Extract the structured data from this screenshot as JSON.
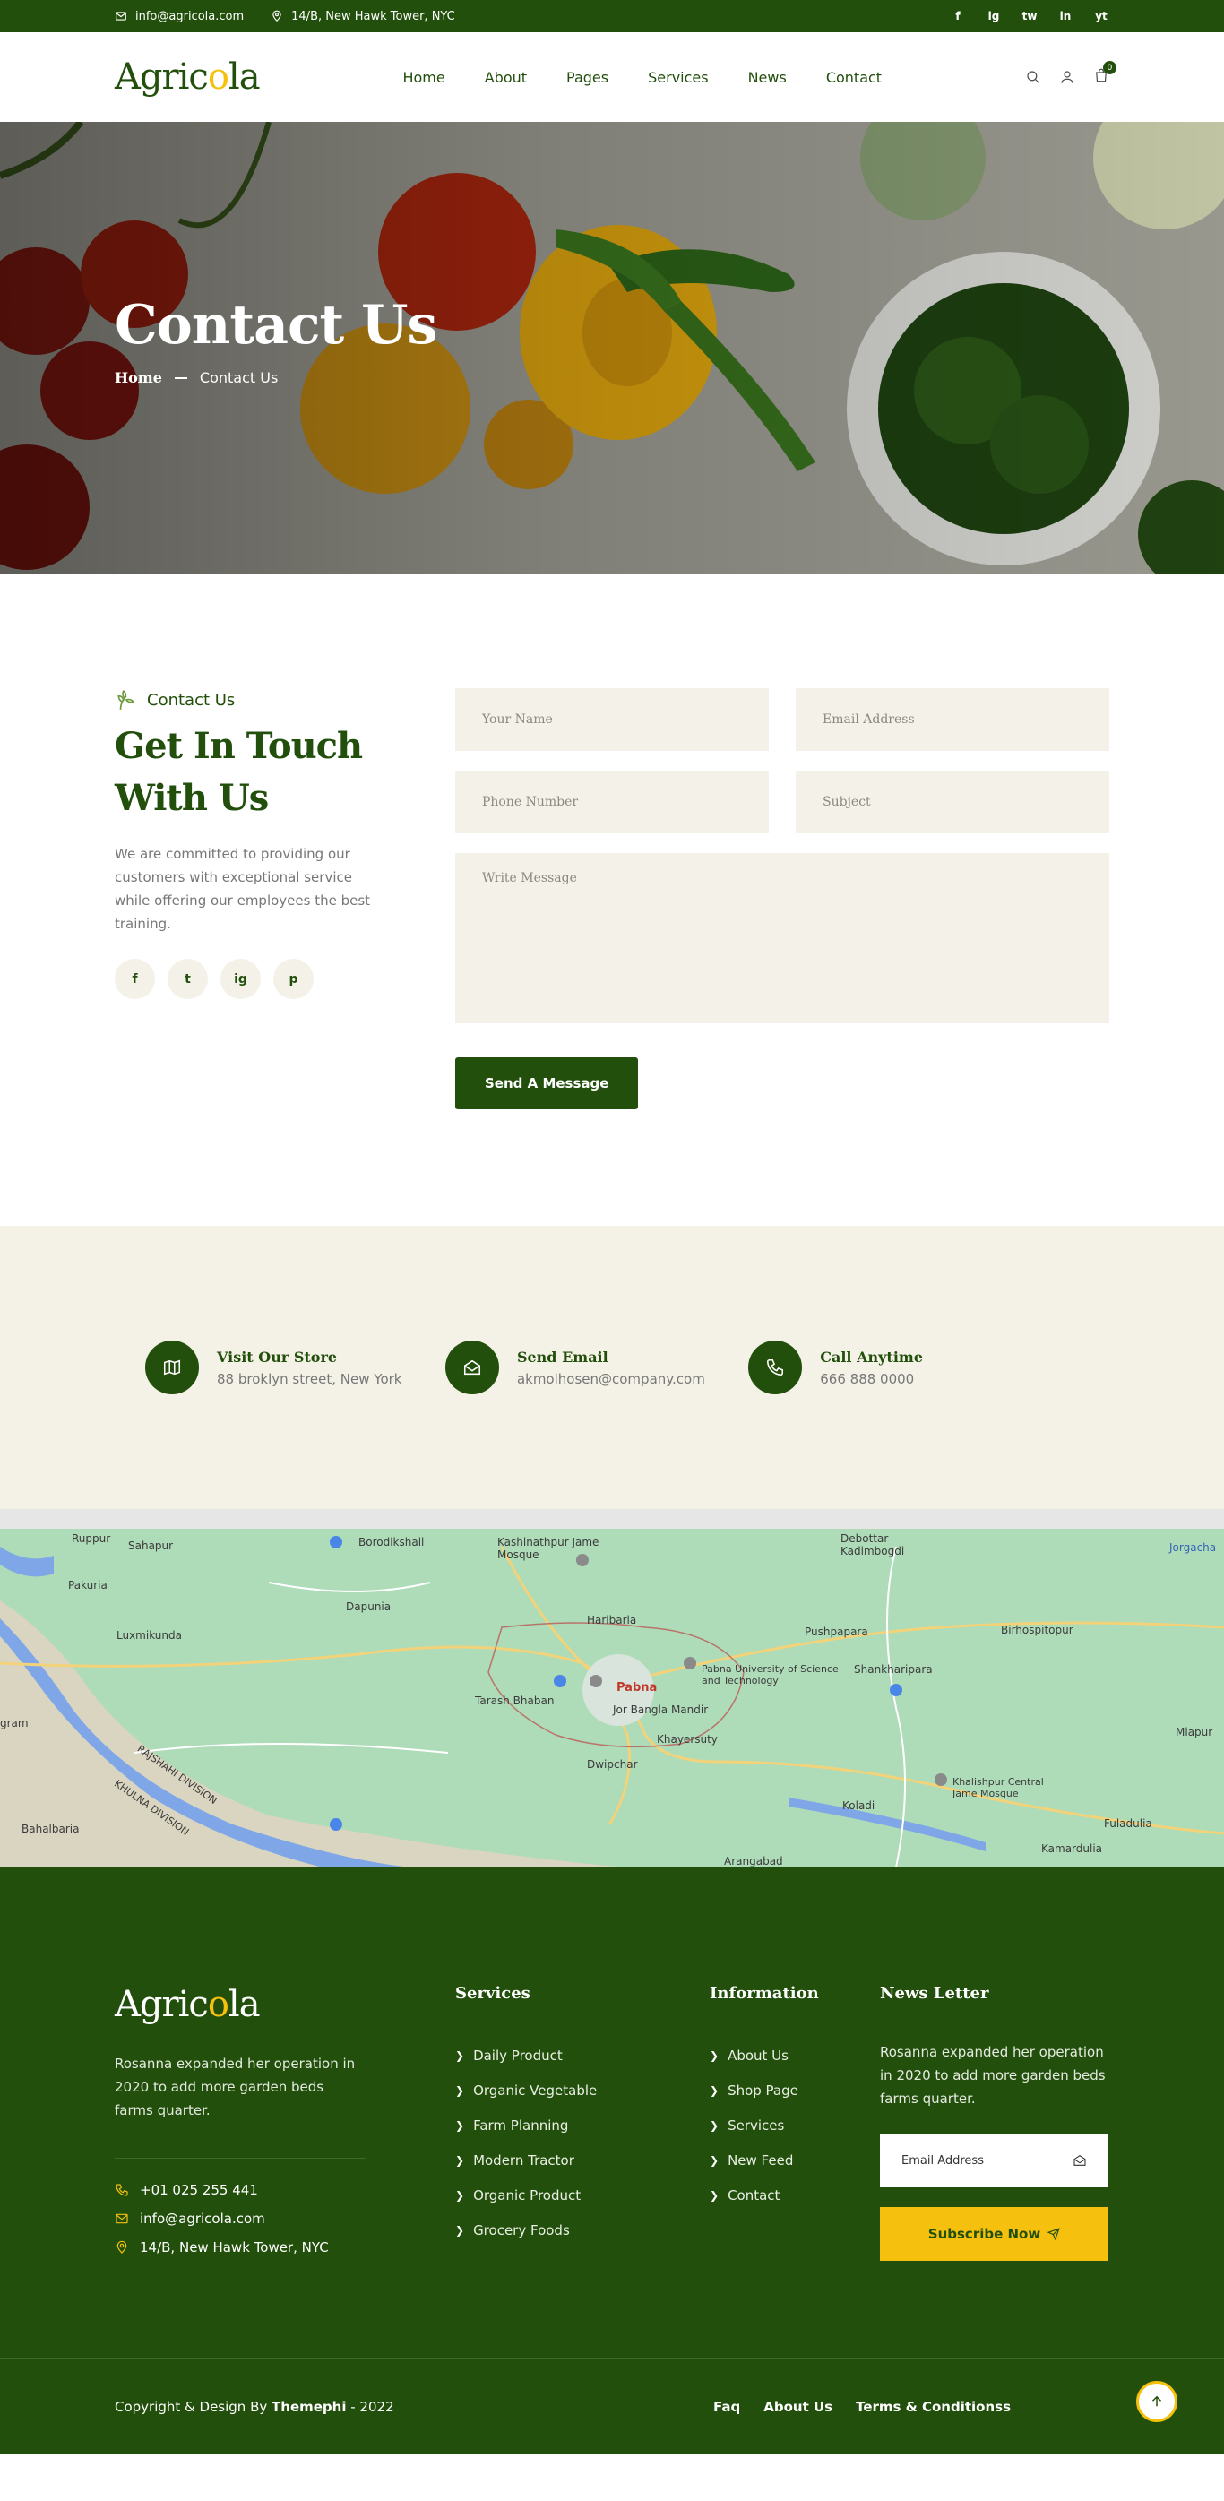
{
  "topbar": {
    "email": "info@agricola.com",
    "address": "14/B, New Hawk Tower, NYC",
    "social": [
      "f",
      "ig",
      "tw",
      "in",
      "yt"
    ]
  },
  "header": {
    "logo_pre": "Agric",
    "logo_o": "o",
    "logo_post": "la",
    "nav": [
      "Home",
      "About",
      "Pages",
      "Services",
      "News",
      "Contact"
    ],
    "cart_count": "0"
  },
  "hero": {
    "title": "Contact Us",
    "crumb_home": "Home",
    "crumb_current": "Contact Us"
  },
  "contact": {
    "eyebrow": "Contact Us",
    "heading_line1": "Get In Touch",
    "heading_line2": "With Us",
    "lead": "We are committed to providing our customers with exceptional service while offering our employees the best training.",
    "social": [
      "f",
      "t",
      "ig",
      "p"
    ],
    "placeholders": {
      "name": "Your Name",
      "email": "Email Address",
      "phone": "Phone Number",
      "subject": "Subject",
      "message": "Write Message"
    },
    "send_label": "Send A Message"
  },
  "info": [
    {
      "title": "Visit Our Store",
      "value": "88 broklyn street, New York",
      "icon": "map-icon"
    },
    {
      "title": "Send Email",
      "value": "akmolhosen@company.com",
      "icon": "mail-open-icon"
    },
    {
      "title": "Call Anytime",
      "value": "666 888 0000",
      "icon": "phone-icon"
    }
  ],
  "map": {
    "labels": {
      "ruppur": "Ruppur",
      "sahapur": "Sahapur",
      "borodikshail": "Borodikshail",
      "kashinathpur": "Kashinathpur Jame Mosque",
      "debottar": "Debottar Kadimbogdi",
      "jorgacha": "Jorgacha",
      "pakuria": "Pakuria",
      "dapunia": "Dapunia",
      "haribaria": "Haribaria",
      "pushpapara": "Pushpapara",
      "birhospitopur": "Birhospitopur",
      "luxmikunda": "Luxmikunda",
      "shankharipara": "Shankharipara",
      "pabna": "Pabna",
      "pabna_uni": "Pabna University of Science and Technology",
      "tarash": "Tarash Bhaban",
      "jor_bangla": "Jor Bangla Mandir",
      "khayersuty": "Khayersuty",
      "dwipchar": "Dwipchar",
      "miapur": "Miapur",
      "rajshahi": "RAJSHAHI DIVISION",
      "khulna": "KHULNA DIVISION",
      "bahalbaria": "Bahalbaria",
      "koladi": "Koladi",
      "khalishpur": "Khalishpur Central Jame Mosque",
      "fuladulia": "Fuladulia",
      "kamardulia": "Kamardulia",
      "arangabad": "Arangabad",
      "gram": "gram"
    }
  },
  "footer": {
    "about": "Rosanna expanded her operation in 2020 to add more garden beds farms quarter.",
    "phone": "+01 025 255 441",
    "email": "info@agricola.com",
    "address": "14/B, New Hawk Tower, NYC",
    "services_title": "Services",
    "services": [
      "Daily Product",
      "Organic Vegetable",
      "Farm Planning",
      "Modern Tractor",
      "Organic Product",
      "Grocery Foods"
    ],
    "info_title": "Information",
    "info_links": [
      "About Us",
      "Shop Page",
      "Services",
      "New Feed",
      "Contact"
    ],
    "news_title": "News Letter",
    "news_text": "Rosanna expanded her operation in 2020 to add more garden beds farms quarter.",
    "news_placeholder": "Email Address",
    "subscribe_label": "Subscribe Now",
    "copyright_pre": "Copyright & Design By ",
    "copyright_brand": "Themephi",
    "copyright_post": " - 2022",
    "bottom_links": [
      "Faq",
      "About Us",
      "Terms & Conditionss"
    ]
  },
  "colors": {
    "primary": "#224f0c",
    "accent": "#f5c10e",
    "cream": "#f4f1e9"
  }
}
